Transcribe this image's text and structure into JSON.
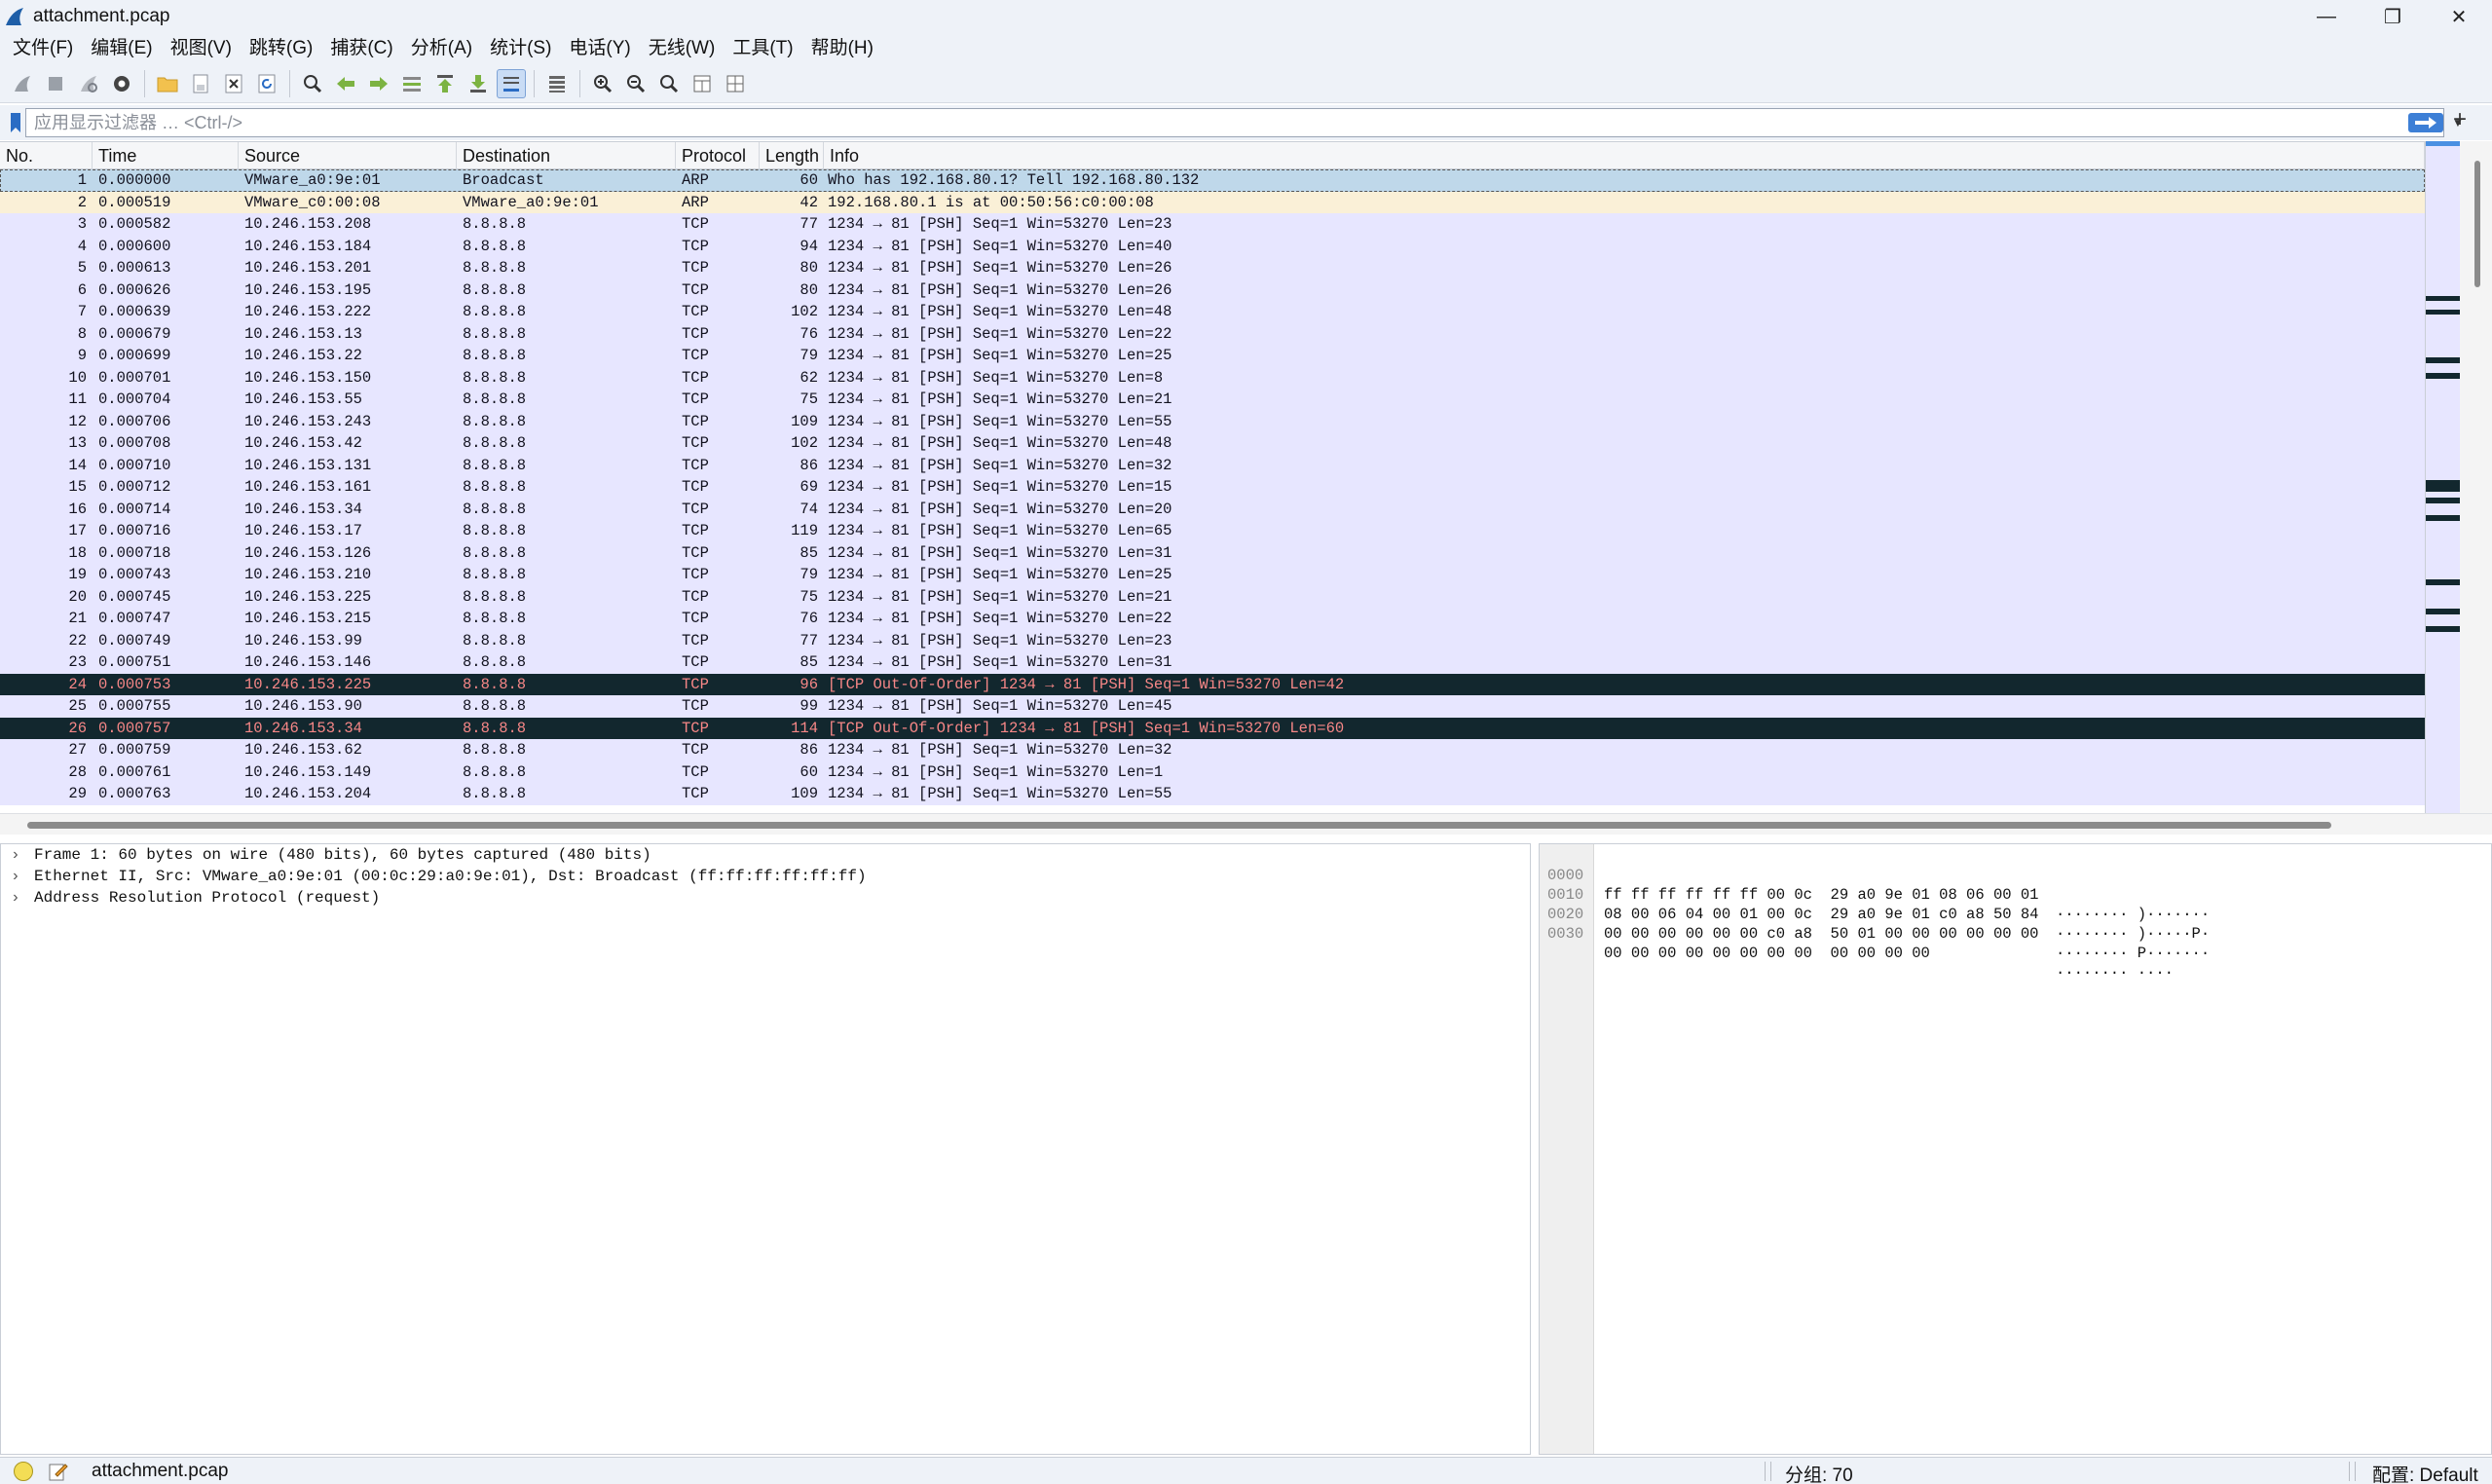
{
  "window": {
    "title": "attachment.pcap",
    "minimize": "—",
    "restore": "❐",
    "close": "✕"
  },
  "menu": [
    "文件(F)",
    "编辑(E)",
    "视图(V)",
    "跳转(G)",
    "捕获(C)",
    "分析(A)",
    "统计(S)",
    "电话(Y)",
    "无线(W)",
    "工具(T)",
    "帮助(H)"
  ],
  "filter": {
    "placeholder": "应用显示过滤器 … <Ctrl-/>",
    "value": "",
    "plus": "+"
  },
  "columns": {
    "no": "No.",
    "time": "Time",
    "source": "Source",
    "destination": "Destination",
    "protocol": "Protocol",
    "length": "Length",
    "info": "Info"
  },
  "packets": [
    {
      "no": "1",
      "time": "0.000000",
      "src": "VMware_a0:9e:01",
      "dst": "Broadcast",
      "proto": "ARP",
      "len": "60",
      "info": "Who has 192.168.80.1? Tell 192.168.80.132",
      "style": "selected"
    },
    {
      "no": "2",
      "time": "0.000519",
      "src": "VMware_c0:00:08",
      "dst": "VMware_a0:9e:01",
      "proto": "ARP",
      "len": "42",
      "info": "192.168.80.1 is at 00:50:56:c0:00:08",
      "style": "arp"
    },
    {
      "no": "3",
      "time": "0.000582",
      "src": "10.246.153.208",
      "dst": "8.8.8.8",
      "proto": "TCP",
      "len": "77",
      "info": "1234 → 81 [PSH] Seq=1 Win=53270 Len=23",
      "style": "tcp"
    },
    {
      "no": "4",
      "time": "0.000600",
      "src": "10.246.153.184",
      "dst": "8.8.8.8",
      "proto": "TCP",
      "len": "94",
      "info": "1234 → 81 [PSH] Seq=1 Win=53270 Len=40",
      "style": "tcp"
    },
    {
      "no": "5",
      "time": "0.000613",
      "src": "10.246.153.201",
      "dst": "8.8.8.8",
      "proto": "TCP",
      "len": "80",
      "info": "1234 → 81 [PSH] Seq=1 Win=53270 Len=26",
      "style": "tcp"
    },
    {
      "no": "6",
      "time": "0.000626",
      "src": "10.246.153.195",
      "dst": "8.8.8.8",
      "proto": "TCP",
      "len": "80",
      "info": "1234 → 81 [PSH] Seq=1 Win=53270 Len=26",
      "style": "tcp"
    },
    {
      "no": "7",
      "time": "0.000639",
      "src": "10.246.153.222",
      "dst": "8.8.8.8",
      "proto": "TCP",
      "len": "102",
      "info": "1234 → 81 [PSH] Seq=1 Win=53270 Len=48",
      "style": "tcp"
    },
    {
      "no": "8",
      "time": "0.000679",
      "src": "10.246.153.13",
      "dst": "8.8.8.8",
      "proto": "TCP",
      "len": "76",
      "info": "1234 → 81 [PSH] Seq=1 Win=53270 Len=22",
      "style": "tcp"
    },
    {
      "no": "9",
      "time": "0.000699",
      "src": "10.246.153.22",
      "dst": "8.8.8.8",
      "proto": "TCP",
      "len": "79",
      "info": "1234 → 81 [PSH] Seq=1 Win=53270 Len=25",
      "style": "tcp"
    },
    {
      "no": "10",
      "time": "0.000701",
      "src": "10.246.153.150",
      "dst": "8.8.8.8",
      "proto": "TCP",
      "len": "62",
      "info": "1234 → 81 [PSH] Seq=1 Win=53270 Len=8",
      "style": "tcp"
    },
    {
      "no": "11",
      "time": "0.000704",
      "src": "10.246.153.55",
      "dst": "8.8.8.8",
      "proto": "TCP",
      "len": "75",
      "info": "1234 → 81 [PSH] Seq=1 Win=53270 Len=21",
      "style": "tcp"
    },
    {
      "no": "12",
      "time": "0.000706",
      "src": "10.246.153.243",
      "dst": "8.8.8.8",
      "proto": "TCP",
      "len": "109",
      "info": "1234 → 81 [PSH] Seq=1 Win=53270 Len=55",
      "style": "tcp"
    },
    {
      "no": "13",
      "time": "0.000708",
      "src": "10.246.153.42",
      "dst": "8.8.8.8",
      "proto": "TCP",
      "len": "102",
      "info": "1234 → 81 [PSH] Seq=1 Win=53270 Len=48",
      "style": "tcp"
    },
    {
      "no": "14",
      "time": "0.000710",
      "src": "10.246.153.131",
      "dst": "8.8.8.8",
      "proto": "TCP",
      "len": "86",
      "info": "1234 → 81 [PSH] Seq=1 Win=53270 Len=32",
      "style": "tcp"
    },
    {
      "no": "15",
      "time": "0.000712",
      "src": "10.246.153.161",
      "dst": "8.8.8.8",
      "proto": "TCP",
      "len": "69",
      "info": "1234 → 81 [PSH] Seq=1 Win=53270 Len=15",
      "style": "tcp"
    },
    {
      "no": "16",
      "time": "0.000714",
      "src": "10.246.153.34",
      "dst": "8.8.8.8",
      "proto": "TCP",
      "len": "74",
      "info": "1234 → 81 [PSH] Seq=1 Win=53270 Len=20",
      "style": "tcp"
    },
    {
      "no": "17",
      "time": "0.000716",
      "src": "10.246.153.17",
      "dst": "8.8.8.8",
      "proto": "TCP",
      "len": "119",
      "info": "1234 → 81 [PSH] Seq=1 Win=53270 Len=65",
      "style": "tcp"
    },
    {
      "no": "18",
      "time": "0.000718",
      "src": "10.246.153.126",
      "dst": "8.8.8.8",
      "proto": "TCP",
      "len": "85",
      "info": "1234 → 81 [PSH] Seq=1 Win=53270 Len=31",
      "style": "tcp"
    },
    {
      "no": "19",
      "time": "0.000743",
      "src": "10.246.153.210",
      "dst": "8.8.8.8",
      "proto": "TCP",
      "len": "79",
      "info": "1234 → 81 [PSH] Seq=1 Win=53270 Len=25",
      "style": "tcp"
    },
    {
      "no": "20",
      "time": "0.000745",
      "src": "10.246.153.225",
      "dst": "8.8.8.8",
      "proto": "TCP",
      "len": "75",
      "info": "1234 → 81 [PSH] Seq=1 Win=53270 Len=21",
      "style": "tcp"
    },
    {
      "no": "21",
      "time": "0.000747",
      "src": "10.246.153.215",
      "dst": "8.8.8.8",
      "proto": "TCP",
      "len": "76",
      "info": "1234 → 81 [PSH] Seq=1 Win=53270 Len=22",
      "style": "tcp"
    },
    {
      "no": "22",
      "time": "0.000749",
      "src": "10.246.153.99",
      "dst": "8.8.8.8",
      "proto": "TCP",
      "len": "77",
      "info": "1234 → 81 [PSH] Seq=1 Win=53270 Len=23",
      "style": "tcp"
    },
    {
      "no": "23",
      "time": "0.000751",
      "src": "10.246.153.146",
      "dst": "8.8.8.8",
      "proto": "TCP",
      "len": "85",
      "info": "1234 → 81 [PSH] Seq=1 Win=53270 Len=31",
      "style": "tcp"
    },
    {
      "no": "24",
      "time": "0.000753",
      "src": "10.246.153.225",
      "dst": "8.8.8.8",
      "proto": "TCP",
      "len": "96",
      "info": "[TCP Out-Of-Order] 1234 → 81 [PSH] Seq=1 Win=53270 Len=42",
      "style": "bad"
    },
    {
      "no": "25",
      "time": "0.000755",
      "src": "10.246.153.90",
      "dst": "8.8.8.8",
      "proto": "TCP",
      "len": "99",
      "info": "1234 → 81 [PSH] Seq=1 Win=53270 Len=45",
      "style": "tcp"
    },
    {
      "no": "26",
      "time": "0.000757",
      "src": "10.246.153.34",
      "dst": "8.8.8.8",
      "proto": "TCP",
      "len": "114",
      "info": "[TCP Out-Of-Order] 1234 → 81 [PSH] Seq=1 Win=53270 Len=60",
      "style": "bad"
    },
    {
      "no": "27",
      "time": "0.000759",
      "src": "10.246.153.62",
      "dst": "8.8.8.8",
      "proto": "TCP",
      "len": "86",
      "info": "1234 → 81 [PSH] Seq=1 Win=53270 Len=32",
      "style": "tcp"
    },
    {
      "no": "28",
      "time": "0.000761",
      "src": "10.246.153.149",
      "dst": "8.8.8.8",
      "proto": "TCP",
      "len": "60",
      "info": "1234 → 81 [PSH] Seq=1 Win=53270 Len=1",
      "style": "tcp"
    },
    {
      "no": "29",
      "time": "0.000763",
      "src": "10.246.153.204",
      "dst": "8.8.8.8",
      "proto": "TCP",
      "len": "109",
      "info": "1234 → 81 [PSH] Seq=1 Win=53270 Len=55",
      "style": "tcp"
    }
  ],
  "details": [
    {
      "chevron": "›",
      "text": "Frame 1: 60 bytes on wire (480 bits), 60 bytes captured (480 bits)"
    },
    {
      "chevron": "›",
      "text": "Ethernet II, Src: VMware_a0:9e:01 (00:0c:29:a0:9e:01), Dst: Broadcast (ff:ff:ff:ff:ff:ff)"
    },
    {
      "chevron": "›",
      "text": "Address Resolution Protocol (request)"
    }
  ],
  "bytes": [
    {
      "offset": "0000",
      "hex": "ff ff ff ff ff ff 00 0c  29 a0 9e 01 08 06 00 01",
      "ascii": "········ )·······"
    },
    {
      "offset": "0010",
      "hex": "08 00 06 04 00 01 00 0c  29 a0 9e 01 c0 a8 50 84",
      "ascii": "········ )·····P·"
    },
    {
      "offset": "0020",
      "hex": "00 00 00 00 00 00 c0 a8  50 01 00 00 00 00 00 00",
      "ascii": "········ P·······"
    },
    {
      "offset": "0030",
      "hex": "00 00 00 00 00 00 00 00  00 00 00 00",
      "ascii": "········ ····"
    }
  ],
  "status": {
    "file": "attachment.pcap",
    "packets": "分组: 70",
    "profile": "配置: Default"
  },
  "colors": {
    "tcp_row": "#e7e6ff",
    "arp_row": "#faf0d7",
    "selected_row": "#bfd8ea",
    "bad_row_bg": "#12272e",
    "bad_row_fg": "#f78787"
  }
}
